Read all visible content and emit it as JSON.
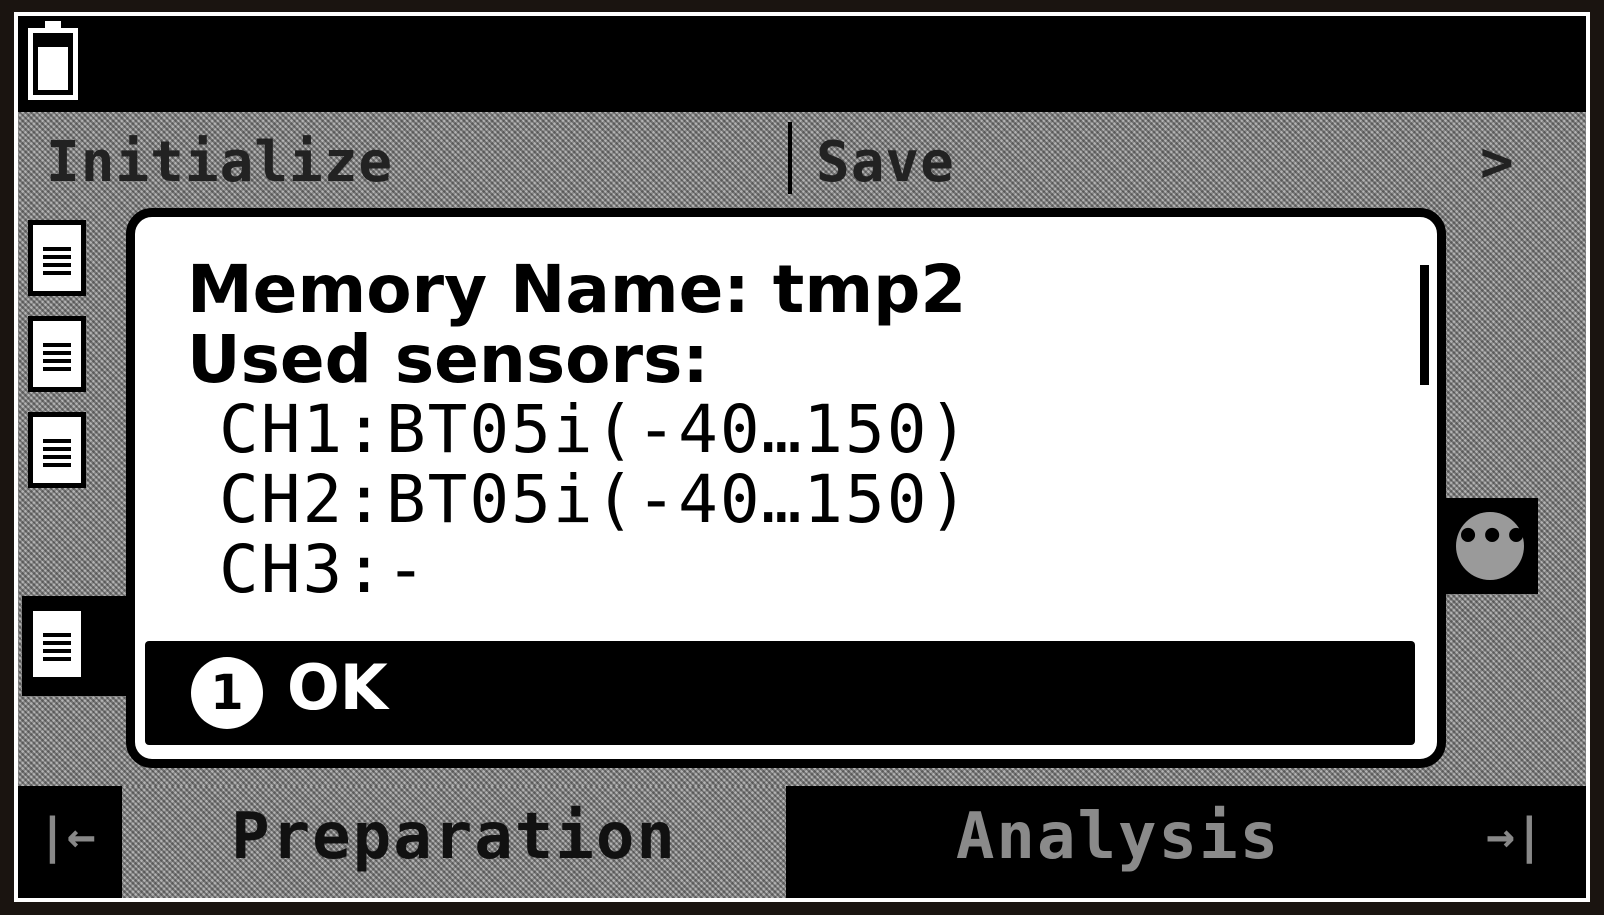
{
  "menu": {
    "initialize": "Initialize",
    "save": "Save",
    "next": ">"
  },
  "dialog": {
    "memory_name": "Memory Name: tmp2",
    "used_sensors": "Used sensors:",
    "sensors": [
      "CH1:BT05i(-40…150)",
      "CH2:BT05i(-40…150)",
      "CH3:-"
    ],
    "ok_number": "1",
    "ok_label": "OK"
  },
  "more_button": "•••",
  "tabs": {
    "first": "|←",
    "preparation": "Preparation",
    "analysis": "Analysis",
    "last": "→|"
  },
  "icons": [
    "battery-icon",
    "file-icon",
    "more-icon",
    "first-page-icon",
    "last-page-icon"
  ]
}
